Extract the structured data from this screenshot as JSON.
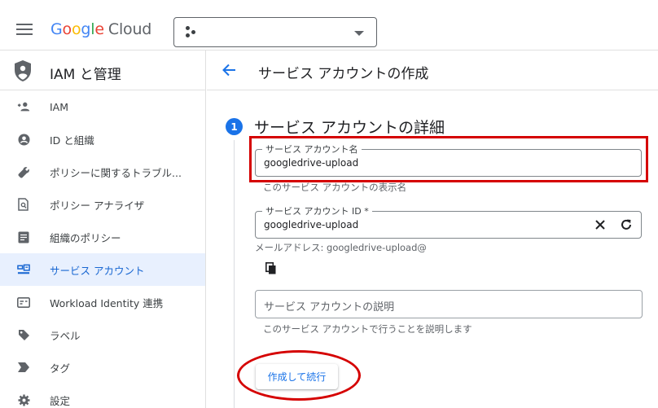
{
  "header": {
    "logo_google": [
      "G",
      "o",
      "o",
      "g",
      "l",
      "e"
    ],
    "logo_cloud": "Cloud"
  },
  "sidebar": {
    "title": "IAM と管理",
    "items": [
      {
        "label": "IAM",
        "icon": "person-add-icon"
      },
      {
        "label": "ID と組織",
        "icon": "account-circle-icon"
      },
      {
        "label": "ポリシーに関するトラブル...",
        "icon": "wrench-icon"
      },
      {
        "label": "ポリシー アナライザ",
        "icon": "document-search-icon"
      },
      {
        "label": "組織のポリシー",
        "icon": "document-list-icon"
      },
      {
        "label": "サービス アカウント",
        "icon": "service-account-icon",
        "active": true
      },
      {
        "label": "Workload Identity 連携",
        "icon": "id-card-icon"
      },
      {
        "label": "ラベル",
        "icon": "label-tag-icon"
      },
      {
        "label": "タグ",
        "icon": "tag-chevron-icon"
      },
      {
        "label": "設定",
        "icon": "gear-icon"
      }
    ]
  },
  "main": {
    "title": "サービス アカウントの作成",
    "step": {
      "number": "1",
      "title": "サービス アカウントの詳細"
    },
    "name_field": {
      "label": "サービス アカウント名",
      "value": "googledrive-upload",
      "hint": "このサービス アカウントの表示名"
    },
    "id_field": {
      "label": "サービス アカウント ID *",
      "value": "googledrive-upload",
      "email": "メールアドレス: googledrive-upload@"
    },
    "desc_field": {
      "placeholder": "サービス アカウントの説明",
      "hint": "このサービス アカウントで行うことを説明します"
    },
    "create_button": "作成して続行"
  },
  "colors": {
    "accent": "#1a73e8",
    "active_bg": "#e8f0fe",
    "annotation": "#d50000"
  }
}
